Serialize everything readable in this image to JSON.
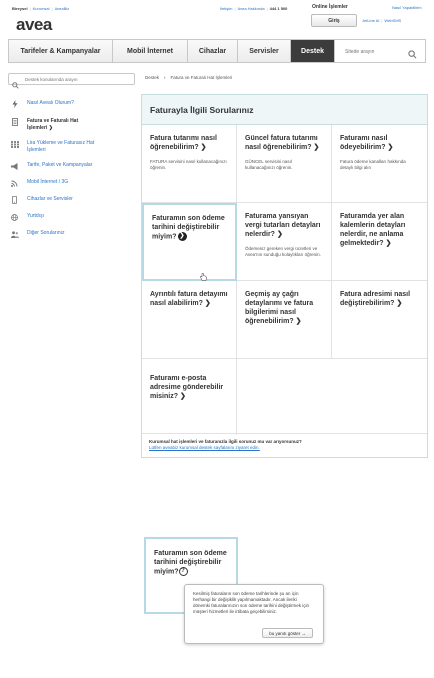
{
  "topbar": {
    "links": [
      "Bireysel",
      "Kurumsal",
      "AveaBiz"
    ],
    "mid_links": [
      "İletişim",
      "Avea Hakkında"
    ],
    "phone": "444 1 500",
    "online_title": "Online İşlemler",
    "help": "Nasıl Yapabilirim",
    "login_label": "Giriş",
    "small_links": [
      "JetLine Al",
      "WebSMS"
    ],
    "logo": "avea"
  },
  "nav": {
    "items": [
      "Tarifeler & Kampanyalar",
      "Mobil İnternet",
      "Cihazlar",
      "Servisler",
      "Destek"
    ],
    "active_index": 4,
    "search_placeholder": "Sitede arayın"
  },
  "sidebar": {
    "search_placeholder": "Destek konularında arayın",
    "items": [
      {
        "label": "Nasıl Avealı Olurum?",
        "icon": "lightning-icon"
      },
      {
        "label": "Fatura ve Faturalı Hat İşlemleri",
        "icon": "document-icon",
        "active": true
      },
      {
        "label": "Lira Yükleme ve Faturasız Hat İşlemleri",
        "icon": "grid-icon"
      },
      {
        "label": "Tarife, Paket ve Kampanyalar",
        "icon": "megaphone-icon"
      },
      {
        "label": "Mobil İnternet / 3G",
        "icon": "signal-icon"
      },
      {
        "label": "Cihazlar ve Servisler",
        "icon": "phone-icon"
      },
      {
        "label": "Yurtdışı",
        "icon": "globe-icon"
      },
      {
        "label": "Diğer Sorularınız",
        "icon": "people-icon"
      }
    ]
  },
  "breadcrumb": [
    "Destek",
    "Fatura ve Faturalı Hat İşlemleri"
  ],
  "faq": {
    "title": "Faturayla İlgili Sorularınız",
    "cells": [
      {
        "q": "Fatura tutarımı nasıl öğrenebilirim?",
        "d": "FATURA servisini nasıl kullanacağınızı öğrenin."
      },
      {
        "q": "Güncel fatura tutarımı nasıl öğrenebilirim?",
        "d": "GÜNCEL servisini nasıl kullanacağınızı öğrenin."
      },
      {
        "q": "Faturamı nasıl ödeyebilirim?",
        "d": "Fatura ödeme kanalları hakkında detaylı bilgi alın"
      },
      {
        "q": "Faturamın son ödeme tarihini değiştirebilir miyim?",
        "d": ""
      },
      {
        "q": "Faturama yansıyan vergi tutarları detayları nelerdir?",
        "d": "Ödemeniz gereken vergi ücretleri ve Avea'nın sunduğu kolaylıkları öğrenin."
      },
      {
        "q": "Faturamda yer alan kalemlerin detayları nelerdir, ne anlama gelmektedir?",
        "d": ""
      },
      {
        "q": "Ayrıntılı fatura detayımı nasıl alabilirim?",
        "d": ""
      },
      {
        "q": "Geçmiş ay çağrı detaylarımı ve fatura bilgilerimi nasıl öğrenebilirim?",
        "d": ""
      },
      {
        "q": "Fatura adresimi nasıl değiştirebilirim?",
        "d": ""
      },
      {
        "q": "Faturamı e-posta adresime gönderebilir misiniz?",
        "d": ""
      }
    ],
    "footer_question": "Kurumsal hat işlemleri ve faturanızla ilgili sorunuz mu var arıyorsunuz?",
    "footer_link": "Lütfen aveabiz kurumsal destek sayfalarını ziyaret edin."
  },
  "callout": {
    "question": "Faturamın son ödeme tarihini değiştirebilir miyim?",
    "tooltip_text": "Kesilmiş faturaların son ödeme tarihlerinde şu an için herhangi bir değişiklik yapılmamaktadır. Ancak ileriki dönemki faturalarınızın son ödeme tarihini değiştirmek için müşteri hizmetleri ile irtibata geçebilirsiniz.",
    "tooltip_button": "bu yanıtı göster →"
  },
  "colors": {
    "link_blue": "#2a74c9",
    "active_nav": "#3c3c3c",
    "panel_header": "#eef6f7",
    "highlight_border": "#b7d9e6"
  }
}
